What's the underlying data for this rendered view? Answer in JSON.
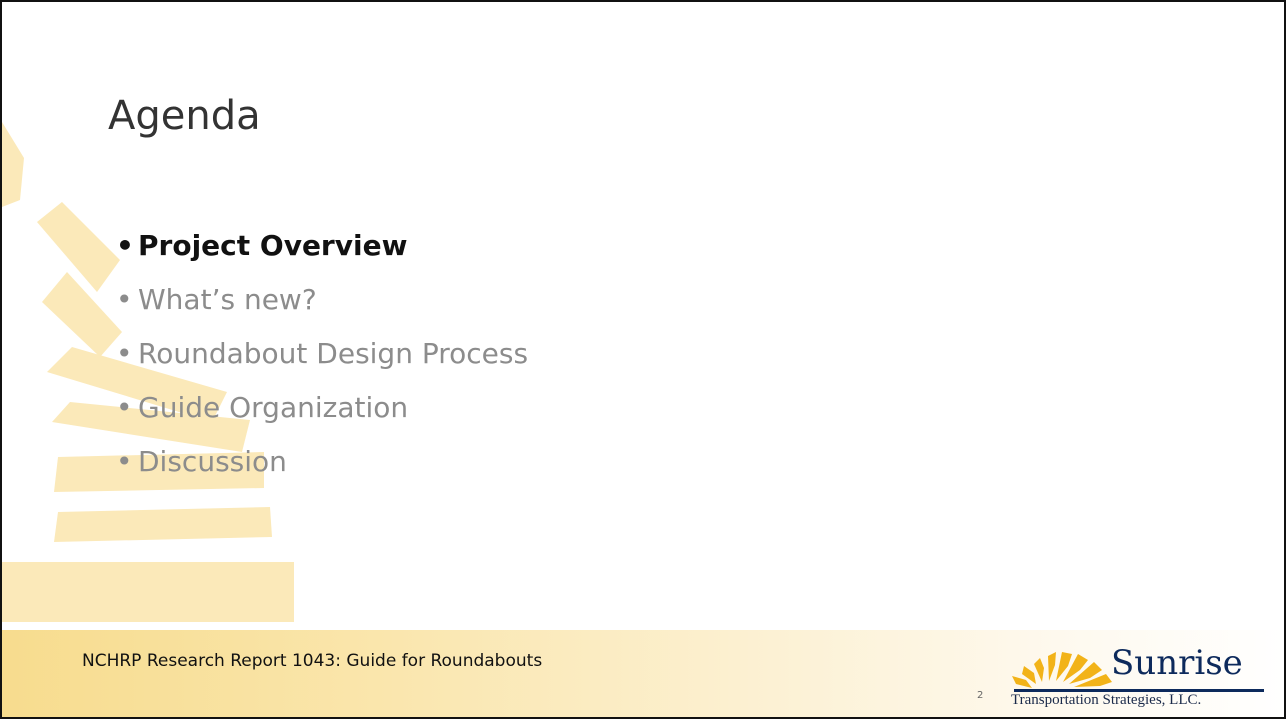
{
  "slide": {
    "title": "Agenda",
    "agenda_items": [
      {
        "label": "Project Overview",
        "current": true
      },
      {
        "label": "What’s new?",
        "current": false
      },
      {
        "label": "Roundabout Design Process",
        "current": false
      },
      {
        "label": "Guide Organization",
        "current": false
      },
      {
        "label": "Discussion",
        "current": false
      }
    ],
    "bullet": "•",
    "page_number": "2"
  },
  "footer": {
    "text": "NCHRP Research Report 1043: Guide for Roundabouts"
  },
  "logo": {
    "name": "Sunrise",
    "tagline": "Transportation Strategies, LLC."
  },
  "colors": {
    "ray_fill": "#fbe9b9",
    "footer_gold": "#f7dc8e",
    "logo_navy": "#0d2a5c",
    "logo_sun": "#f2b318"
  }
}
